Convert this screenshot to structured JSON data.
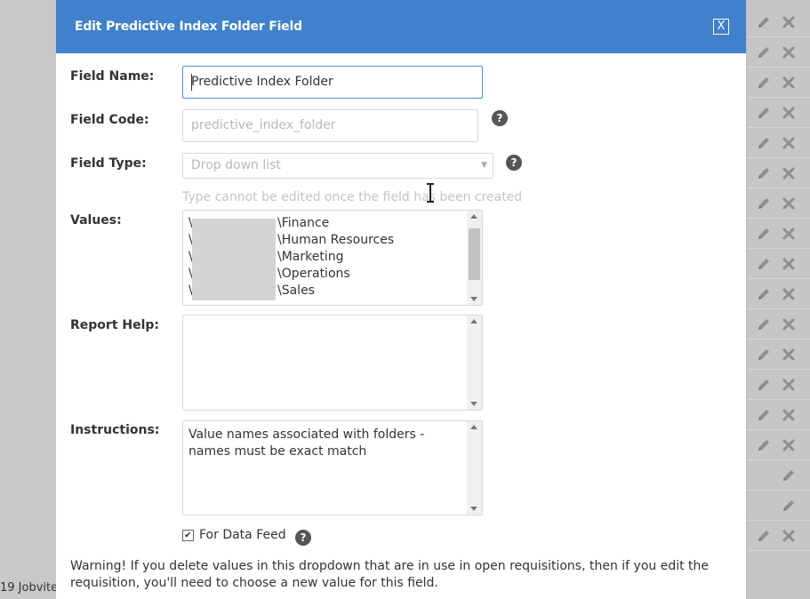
{
  "background": {
    "footer_text": "19 Jobvite",
    "right_rows": [
      {
        "edit": true,
        "delete": true
      },
      {
        "edit": true,
        "delete": true
      },
      {
        "edit": true,
        "delete": true
      },
      {
        "edit": true,
        "delete": true
      },
      {
        "edit": true,
        "delete": true
      },
      {
        "edit": true,
        "delete": true
      },
      {
        "edit": true,
        "delete": true
      },
      {
        "edit": true,
        "delete": true
      },
      {
        "edit": true,
        "delete": true
      },
      {
        "edit": true,
        "delete": true
      },
      {
        "edit": true,
        "delete": true
      },
      {
        "edit": true,
        "delete": true
      },
      {
        "edit": true,
        "delete": true
      },
      {
        "edit": true,
        "delete": true
      },
      {
        "edit": true,
        "delete": true
      },
      {
        "edit": false,
        "delete": false
      },
      {
        "edit": false,
        "delete": false
      },
      {
        "edit": true,
        "delete": true
      }
    ]
  },
  "dialog": {
    "title": "Edit Predictive Index Folder Field",
    "close_label": "X",
    "header_color": "#3f81cc",
    "field_name": {
      "label": "Field Name:",
      "value": "Predictive Index Folder"
    },
    "field_code": {
      "label": "Field Code:",
      "placeholder": "predictive_index_folder"
    },
    "field_type": {
      "label": "Field Type:",
      "value": "Drop down list",
      "hint": "Type cannot be edited once the field has been created"
    },
    "values": {
      "label": "Values:",
      "items": [
        "\\Finance",
        "\\Human Resources",
        "\\Marketing",
        "\\Operations",
        "\\Sales"
      ],
      "prefix_char": "\\"
    },
    "report_help": {
      "label": "Report Help:",
      "value": ""
    },
    "instructions": {
      "label": "Instructions:",
      "value": "Value names associated with folders - names must be exact match"
    },
    "data_feed": {
      "label": "For Data Feed",
      "checked": true
    },
    "warning": "Warning! If you delete values in this dropdown that are in use in open requisitions, then if you edit the requisition, you'll need to choose a new value for this field."
  }
}
